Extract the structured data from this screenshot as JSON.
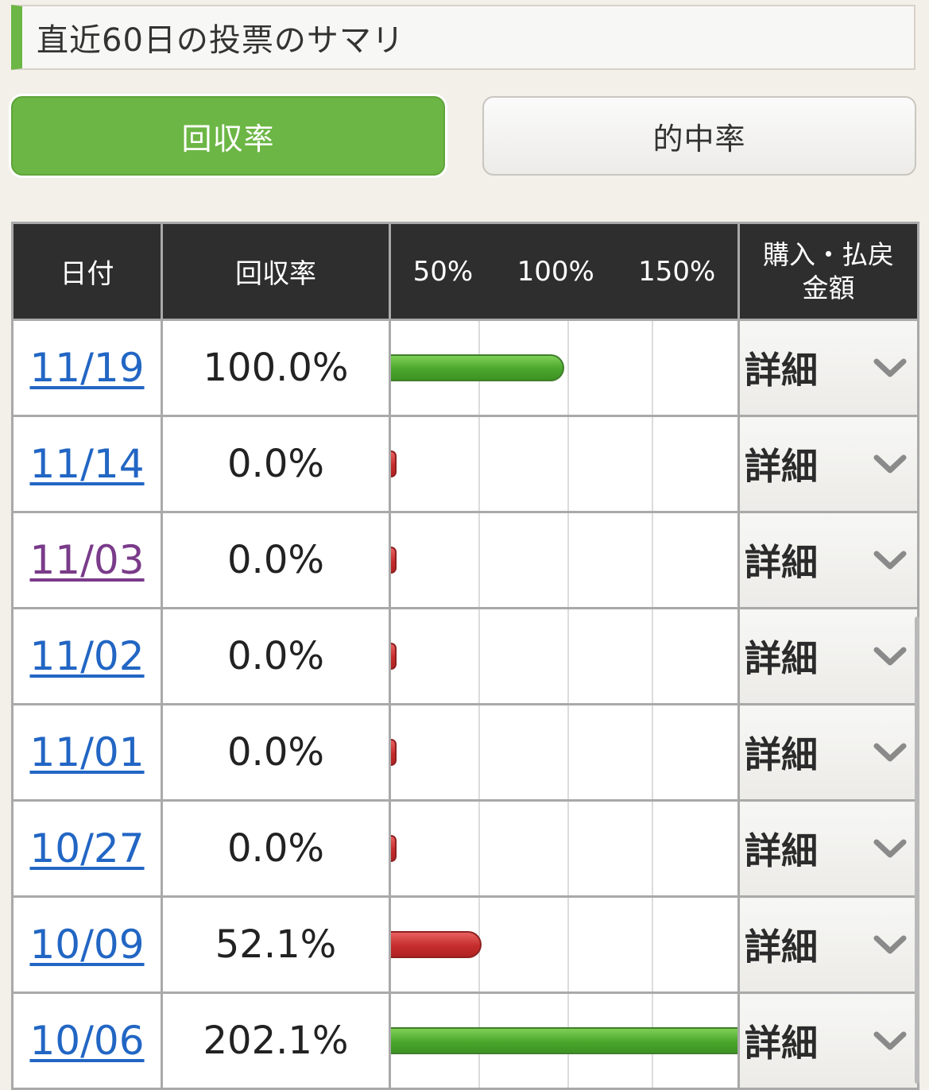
{
  "header": {
    "title": "直近60日の投票のサマリ"
  },
  "tabs": [
    {
      "label": "回収率",
      "active": true
    },
    {
      "label": "的中率",
      "active": false
    }
  ],
  "table": {
    "columns": {
      "date": "日付",
      "rate": "回収率",
      "scale": [
        "50%",
        "100%",
        "150%"
      ],
      "amount_line1": "購入・払戻",
      "amount_line2": "金額"
    },
    "detail_label": "詳細",
    "rows": [
      {
        "date": "11/19",
        "rate": "100.0%",
        "value": 100.0,
        "visited": false
      },
      {
        "date": "11/14",
        "rate": "0.0%",
        "value": 0.0,
        "visited": false
      },
      {
        "date": "11/03",
        "rate": "0.0%",
        "value": 0.0,
        "visited": true
      },
      {
        "date": "11/02",
        "rate": "0.0%",
        "value": 0.0,
        "visited": false
      },
      {
        "date": "11/01",
        "rate": "0.0%",
        "value": 0.0,
        "visited": false
      },
      {
        "date": "10/27",
        "rate": "0.0%",
        "value": 0.0,
        "visited": false
      },
      {
        "date": "10/09",
        "rate": "52.1%",
        "value": 52.1,
        "visited": false
      },
      {
        "date": "10/06",
        "rate": "202.1%",
        "value": 202.1,
        "visited": false
      }
    ]
  },
  "colors": {
    "accent_green": "#6cb645",
    "bar_win": "#4aa62c",
    "bar_lose": "#c62d2d",
    "link": "#2266c4",
    "link_visited": "#7a3b8a"
  }
}
